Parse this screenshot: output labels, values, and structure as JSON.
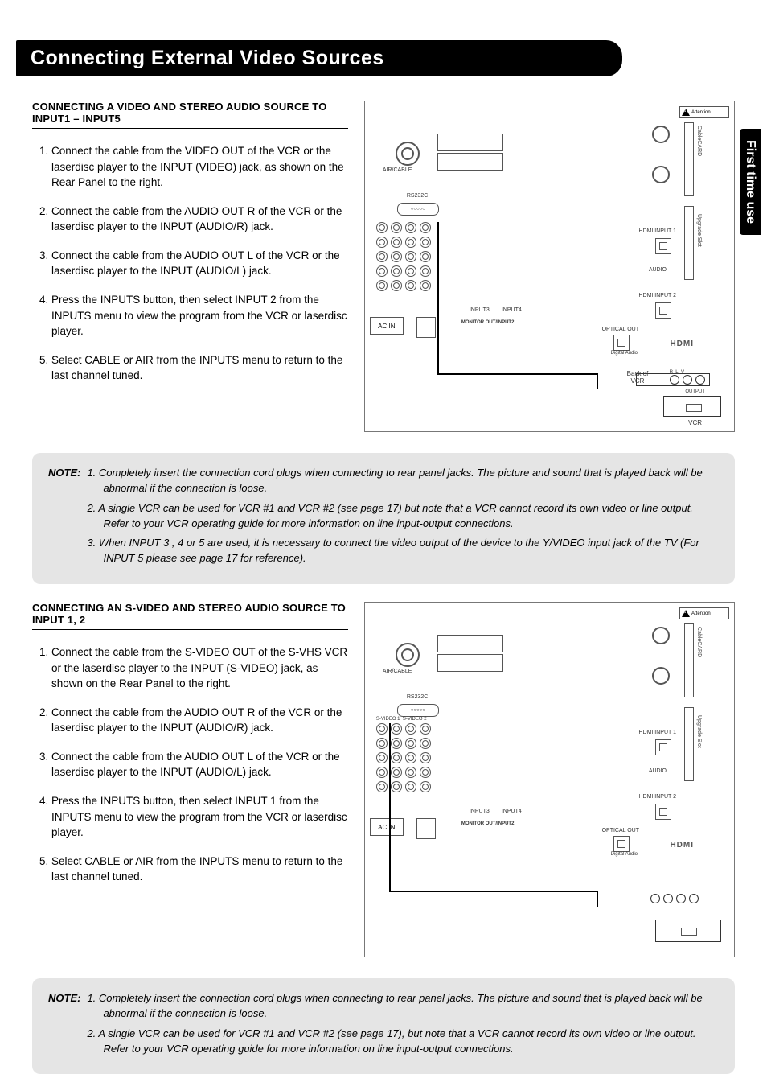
{
  "page_title": "Connecting External Video Sources",
  "side_tab": "First time use",
  "section1": {
    "heading": "CONNECTING A VIDEO AND STEREO AUDIO SOURCE TO INPUT1 – INPUT5",
    "steps": [
      "Connect the cable from the VIDEO OUT of the VCR or the laserdisc player to the INPUT (VIDEO) jack, as shown on the Rear Panel to the right.",
      "Connect the cable from the AUDIO OUT R of the VCR or the laserdisc player to the INPUT (AUDIO/R) jack.",
      "Connect the cable from the AUDIO OUT L of the VCR or the laserdisc player to the INPUT (AUDIO/L) jack.",
      "Press the INPUTS button, then select INPUT 2 from the INPUTS menu to view the program from the VCR or laserdisc player.",
      "Select CABLE or AIR from the INPUTS menu to return to the last channel tuned."
    ]
  },
  "note1": {
    "label": "NOTE:",
    "items": [
      "1.  Completely insert the connection cord plugs when connecting to rear panel jacks. The picture and sound that is played back will be abnormal if the connection is loose.",
      "2.  A single VCR can be used for VCR #1 and VCR #2 (see page 17) but note that a VCR cannot record its own video or line output. Refer to your VCR operating guide for more information on line input-output connections.",
      "3.  When INPUT 3 , 4 or 5 are used, it is necessary to connect the video output of the device to the Y/VIDEO input jack of the TV (For INPUT 5 please see page 17 for reference)."
    ]
  },
  "section2": {
    "heading": "CONNECTING AN S-VIDEO AND STEREO AUDIO SOURCE TO INPUT 1, 2",
    "steps": [
      "Connect the cable from the S-VIDEO OUT of the S-VHS VCR or the laserdisc player to the INPUT (S-VIDEO) jack, as shown on the Rear Panel to the right.",
      "Connect the cable from the AUDIO OUT R of the VCR or the laserdisc player to the INPUT (AUDIO/R) jack.",
      "Connect the cable from the AUDIO OUT L of the VCR or the laserdisc player to the INPUT (AUDIO/L) jack.",
      "Press the INPUTS button, then select INPUT 1 from the INPUTS menu to view the program from the VCR or laserdisc player.",
      "Select CABLE or AIR from the INPUTS menu to return to the last channel tuned."
    ]
  },
  "note2": {
    "label": "NOTE:",
    "items": [
      "1.  Completely insert the connection cord plugs when connecting to rear panel jacks. The picture and sound that is played back will be abnormal if the connection is loose.",
      "2.  A single VCR can be used for VCR #1 and VCR #2 (see page 17), but note that a VCR cannot record its own video or line output. Refer to your VCR operating guide for more information on line input-output connections."
    ]
  },
  "diagram_labels": {
    "attention": "Attention",
    "air_cable": "AIR/CABLE",
    "ac_in": "AC IN",
    "rs232c": "RS232C",
    "input3": "INPUT3",
    "input4": "INPUT4",
    "optical_out": "OPTICAL OUT",
    "digital_audio": "Digital Audio",
    "hdmi": "HDMI",
    "hdmi_input1": "HDMI INPUT 1",
    "hdmi_input2": "HDMI INPUT 2",
    "audio": "AUDIO",
    "back_of_vcr": "Back of VCR",
    "vcr": "VCR",
    "output": "OUTPUT",
    "r": "R",
    "l": "L",
    "v": "V",
    "cablecard": "CableCARD",
    "upgrade_slot": "Upgrade Slot",
    "monitor_out": "MONITOR OUT/INPUT2",
    "svideo1": "S-VIDEO 1",
    "svideo2": "S-VIDEO 2"
  }
}
